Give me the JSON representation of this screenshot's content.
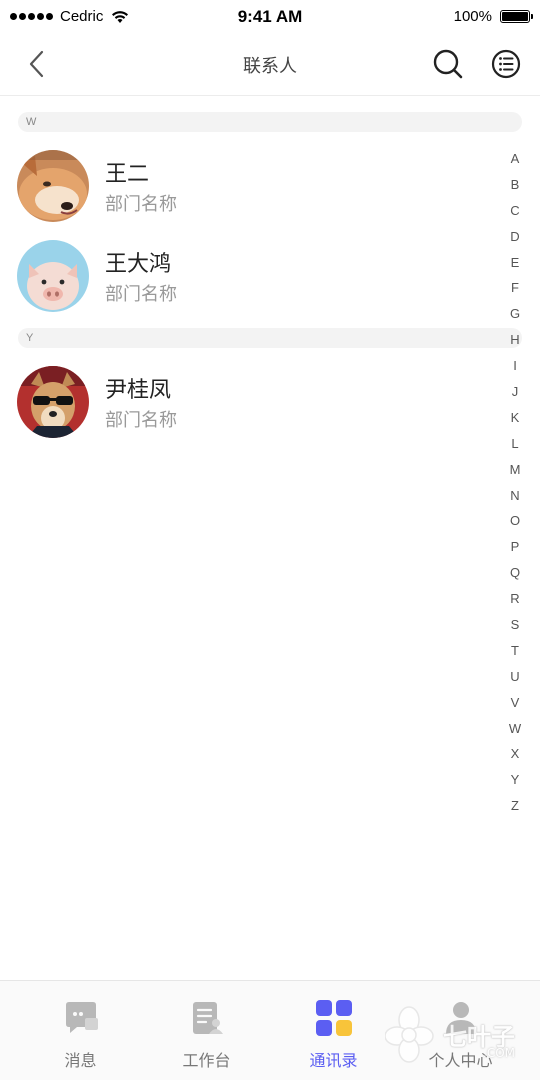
{
  "status_bar": {
    "carrier": "Cedric",
    "time": "9:41 AM",
    "battery": "100%"
  },
  "nav": {
    "title": "联系人",
    "back_icon": "chevron-left-icon",
    "search_icon": "search-icon",
    "menu_icon": "list-menu-icon"
  },
  "sections": [
    {
      "letter": "W",
      "contacts": [
        {
          "name": "王二",
          "department": "部门名称",
          "avatar": "shiba-dog-avatar"
        },
        {
          "name": "王大鸿",
          "department": "部门名称",
          "avatar": "piglet-avatar"
        }
      ]
    },
    {
      "letter": "Y",
      "contacts": [
        {
          "name": "尹桂凤",
          "department": "部门名称",
          "avatar": "dog-with-sunglasses-avatar"
        }
      ]
    }
  ],
  "alphabet_index": [
    "A",
    "B",
    "C",
    "D",
    "E",
    "F",
    "G",
    "H",
    "I",
    "J",
    "K",
    "L",
    "M",
    "N",
    "O",
    "P",
    "Q",
    "R",
    "S",
    "T",
    "U",
    "V",
    "W",
    "X",
    "Y",
    "Z"
  ],
  "tab_bar": {
    "active_tab": "通讯录",
    "active_color": "#5b5ef2",
    "tabs": [
      {
        "label": "消息",
        "icon": "message-icon"
      },
      {
        "label": "工作台",
        "icon": "workbench-icon"
      },
      {
        "label": "通讯录",
        "icon": "contacts-grid-icon"
      },
      {
        "label": "个人中心",
        "icon": "person-icon"
      }
    ]
  },
  "watermark": {
    "text": "七叶子",
    "sub": ".COM"
  }
}
